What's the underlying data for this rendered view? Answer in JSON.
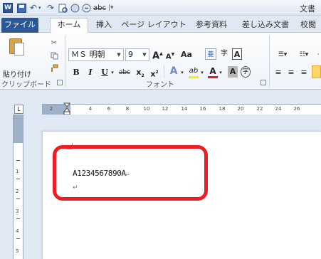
{
  "qat": {
    "app_icon_letter": "W",
    "undo_glyph": "↶",
    "redo_glyph": "↷",
    "preview_glyph": "🗋",
    "title_fragment": "文書"
  },
  "tabs": [
    {
      "label": "ファイル"
    },
    {
      "label": "ホーム"
    },
    {
      "label": "挿入"
    },
    {
      "label": "ページ レイアウト"
    },
    {
      "label": "参考資料"
    },
    {
      "label": "差し込み文書"
    },
    {
      "label": "校閲"
    }
  ],
  "ribbon": {
    "paste_label": "貼り付け",
    "clipboard_label": "クリップボード",
    "font_label": "フォント",
    "font_name": "ＭＳ 明朝",
    "font_size": "9",
    "grow_font": "A",
    "shrink_font": "A",
    "change_case": "Aa",
    "bold": "B",
    "italic": "I",
    "underline": "U",
    "strike": "abc",
    "subscript": "x",
    "superscript": "x",
    "highlight_letter": "ab",
    "font_color_letter": "A",
    "char_shade_letter": "A",
    "enclose_letter": "字",
    "phonetic_letter": "亜",
    "char_border_letter": "A"
  },
  "ruler": {
    "ticks": [
      "2",
      "2",
      "4",
      "6",
      "8",
      "10",
      "12",
      "14",
      "16",
      "18",
      "20",
      "22",
      "24",
      "26"
    ],
    "vticks": [
      "1",
      "2",
      "3",
      "4",
      "5"
    ]
  },
  "document": {
    "line1": "A1234567890A",
    "para_mark": "↵"
  },
  "colors": {
    "highlight_border": "#ee1d23",
    "file_tab": "#2b5797"
  }
}
